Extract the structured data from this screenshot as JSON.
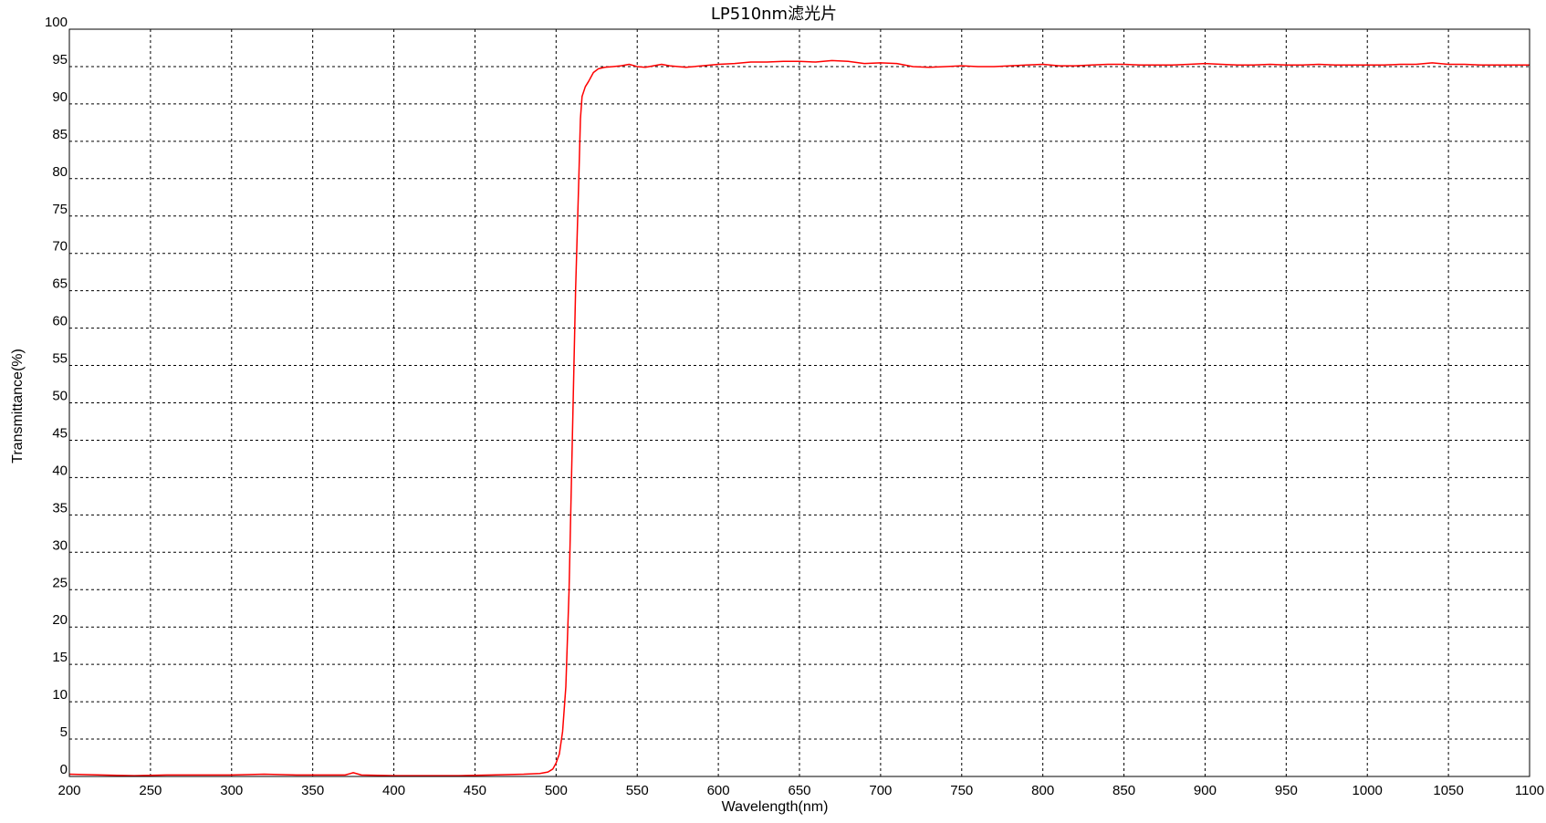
{
  "chart_data": {
    "type": "line",
    "title": "LP510nm滤光片",
    "xlabel": "Wavelength(nm)",
    "ylabel": "Transmittance(%)",
    "xlim": [
      200,
      1100
    ],
    "ylim": [
      0,
      100
    ],
    "x_ticks": [
      200,
      250,
      300,
      350,
      400,
      450,
      500,
      550,
      600,
      650,
      700,
      750,
      800,
      850,
      900,
      950,
      1000,
      1050,
      1100
    ],
    "y_ticks": [
      0,
      5,
      10,
      15,
      20,
      25,
      30,
      35,
      40,
      45,
      50,
      55,
      60,
      65,
      70,
      75,
      80,
      85,
      90,
      95,
      100
    ],
    "grid": true,
    "legend": "none",
    "series": [
      {
        "color": "#ff0000",
        "points": [
          [
            200,
            0.3
          ],
          [
            220,
            0.2
          ],
          [
            240,
            0.1
          ],
          [
            260,
            0.2
          ],
          [
            280,
            0.2
          ],
          [
            300,
            0.2
          ],
          [
            320,
            0.3
          ],
          [
            340,
            0.2
          ],
          [
            360,
            0.2
          ],
          [
            370,
            0.2
          ],
          [
            375,
            0.5
          ],
          [
            380,
            0.2
          ],
          [
            400,
            0.1
          ],
          [
            420,
            0.1
          ],
          [
            440,
            0.1
          ],
          [
            460,
            0.2
          ],
          [
            480,
            0.3
          ],
          [
            490,
            0.4
          ],
          [
            495,
            0.6
          ],
          [
            498,
            1.0
          ],
          [
            500,
            1.8
          ],
          [
            502,
            3.0
          ],
          [
            504,
            6.0
          ],
          [
            506,
            12.0
          ],
          [
            508,
            25.0
          ],
          [
            510,
            45.0
          ],
          [
            512,
            65.0
          ],
          [
            514,
            80.0
          ],
          [
            515,
            88.0
          ],
          [
            516,
            91.0
          ],
          [
            518,
            92.3
          ],
          [
            520,
            93.0
          ],
          [
            523,
            94.2
          ],
          [
            526,
            94.7
          ],
          [
            530,
            94.9
          ],
          [
            535,
            95.0
          ],
          [
            540,
            95.1
          ],
          [
            545,
            95.3
          ],
          [
            550,
            95.0
          ],
          [
            555,
            94.9
          ],
          [
            560,
            95.1
          ],
          [
            565,
            95.3
          ],
          [
            570,
            95.1
          ],
          [
            580,
            94.9
          ],
          [
            590,
            95.1
          ],
          [
            600,
            95.3
          ],
          [
            610,
            95.4
          ],
          [
            620,
            95.6
          ],
          [
            630,
            95.6
          ],
          [
            640,
            95.7
          ],
          [
            650,
            95.7
          ],
          [
            660,
            95.6
          ],
          [
            670,
            95.8
          ],
          [
            680,
            95.7
          ],
          [
            690,
            95.4
          ],
          [
            700,
            95.5
          ],
          [
            710,
            95.4
          ],
          [
            720,
            95.0
          ],
          [
            730,
            94.9
          ],
          [
            740,
            95.0
          ],
          [
            750,
            95.1
          ],
          [
            760,
            95.0
          ],
          [
            770,
            95.0
          ],
          [
            780,
            95.1
          ],
          [
            790,
            95.2
          ],
          [
            800,
            95.3
          ],
          [
            810,
            95.1
          ],
          [
            820,
            95.1
          ],
          [
            830,
            95.2
          ],
          [
            840,
            95.3
          ],
          [
            850,
            95.3
          ],
          [
            860,
            95.2
          ],
          [
            870,
            95.2
          ],
          [
            880,
            95.2
          ],
          [
            890,
            95.3
          ],
          [
            900,
            95.4
          ],
          [
            910,
            95.3
          ],
          [
            920,
            95.2
          ],
          [
            930,
            95.2
          ],
          [
            940,
            95.3
          ],
          [
            950,
            95.2
          ],
          [
            960,
            95.2
          ],
          [
            970,
            95.3
          ],
          [
            980,
            95.2
          ],
          [
            990,
            95.2
          ],
          [
            1000,
            95.2
          ],
          [
            1010,
            95.2
          ],
          [
            1020,
            95.3
          ],
          [
            1030,
            95.3
          ],
          [
            1040,
            95.5
          ],
          [
            1050,
            95.3
          ],
          [
            1060,
            95.3
          ],
          [
            1070,
            95.2
          ],
          [
            1080,
            95.2
          ],
          [
            1090,
            95.2
          ],
          [
            1100,
            95.2
          ]
        ]
      }
    ]
  }
}
